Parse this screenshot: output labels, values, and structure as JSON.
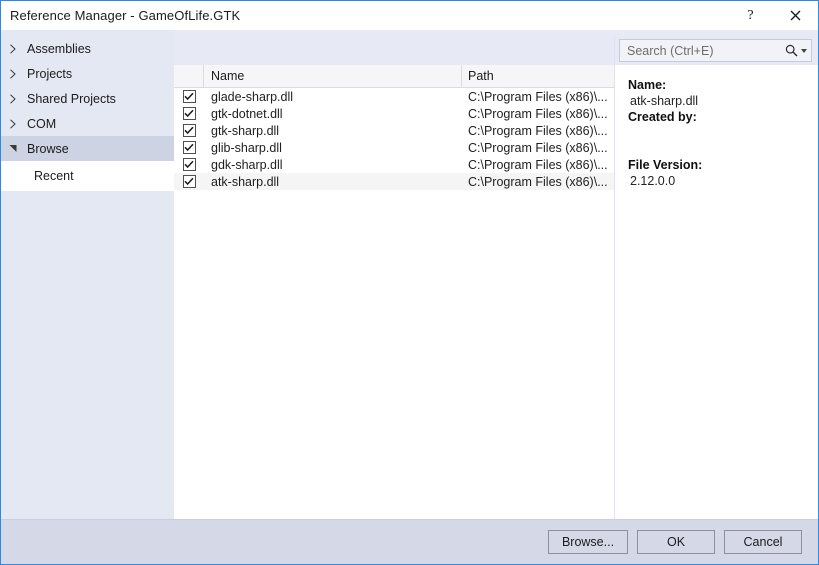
{
  "window": {
    "title": "Reference Manager - GameOfLife.GTK",
    "help_button": "?",
    "close_button": "✕",
    "accent_border": "#2a8ae4"
  },
  "sidebar": {
    "items": [
      {
        "label": "Assemblies",
        "twisty": "chevron-right-icon",
        "selected": false
      },
      {
        "label": "Projects",
        "twisty": "chevron-right-icon",
        "selected": false
      },
      {
        "label": "Shared Projects",
        "twisty": "chevron-right-icon",
        "selected": false
      },
      {
        "label": "COM",
        "twisty": "chevron-right-icon",
        "selected": false
      },
      {
        "label": "Browse",
        "twisty": "chevron-down-icon",
        "selected": true
      }
    ],
    "sub_item": {
      "label": "Recent"
    }
  },
  "search": {
    "placeholder": "Search (Ctrl+E)",
    "icon": "search-icon",
    "dropdown_icon": "chevron-down-icon"
  },
  "grid": {
    "columns": [
      "",
      "Name",
      "Path"
    ],
    "rows": [
      {
        "checked": true,
        "name": "glade-sharp.dll",
        "path": "C:\\Program Files (x86)\\...",
        "selected": false
      },
      {
        "checked": true,
        "name": "gtk-dotnet.dll",
        "path": "C:\\Program Files (x86)\\...",
        "selected": false
      },
      {
        "checked": true,
        "name": "gtk-sharp.dll",
        "path": "C:\\Program Files (x86)\\...",
        "selected": false
      },
      {
        "checked": true,
        "name": "glib-sharp.dll",
        "path": "C:\\Program Files (x86)\\...",
        "selected": false
      },
      {
        "checked": true,
        "name": "gdk-sharp.dll",
        "path": "C:\\Program Files (x86)\\...",
        "selected": false
      },
      {
        "checked": true,
        "name": "atk-sharp.dll",
        "path": "C:\\Program Files (x86)\\...",
        "selected": true
      }
    ]
  },
  "details": {
    "name_label": "Name:",
    "name_value": "atk-sharp.dll",
    "created_by_label": "Created by:",
    "created_by_value": "",
    "file_version_label": "File Version:",
    "file_version_value": "2.12.0.0"
  },
  "footer": {
    "browse_label": "Browse...",
    "ok_label": "OK",
    "cancel_label": "Cancel"
  }
}
